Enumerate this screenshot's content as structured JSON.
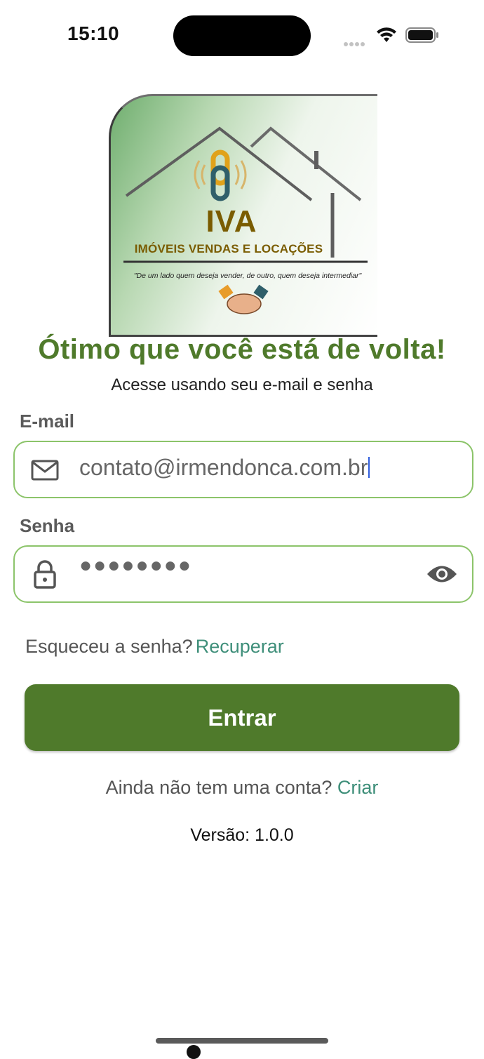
{
  "status_bar": {
    "time": "15:10"
  },
  "logo": {
    "brand": "IVA",
    "subtitle": "IMÓVEIS VENDAS E LOCAÇÕES",
    "slogan": "\"De um lado quem deseja vender, de outro, quem deseja intermediar\""
  },
  "header": {
    "title": "Ótimo que você está de volta!",
    "subtitle": "Acesse usando seu e-mail e senha"
  },
  "email": {
    "label": "E-mail",
    "value": "contato@irmendonca.com.br"
  },
  "password": {
    "label": "Senha",
    "masked_value": "●●●●●●●●"
  },
  "forgot": {
    "text": "Esqueceu a senha?",
    "link": "Recuperar"
  },
  "login_button": {
    "label": "Entrar"
  },
  "signup": {
    "text": "Ainda não tem uma conta?",
    "link": "Criar"
  },
  "version": "Versão: 1.0.0",
  "colors": {
    "primary": "#4f7a2b",
    "link": "#3f8f7a",
    "field_border": "#8cc46a",
    "logo_gold": "#7a5c00"
  }
}
